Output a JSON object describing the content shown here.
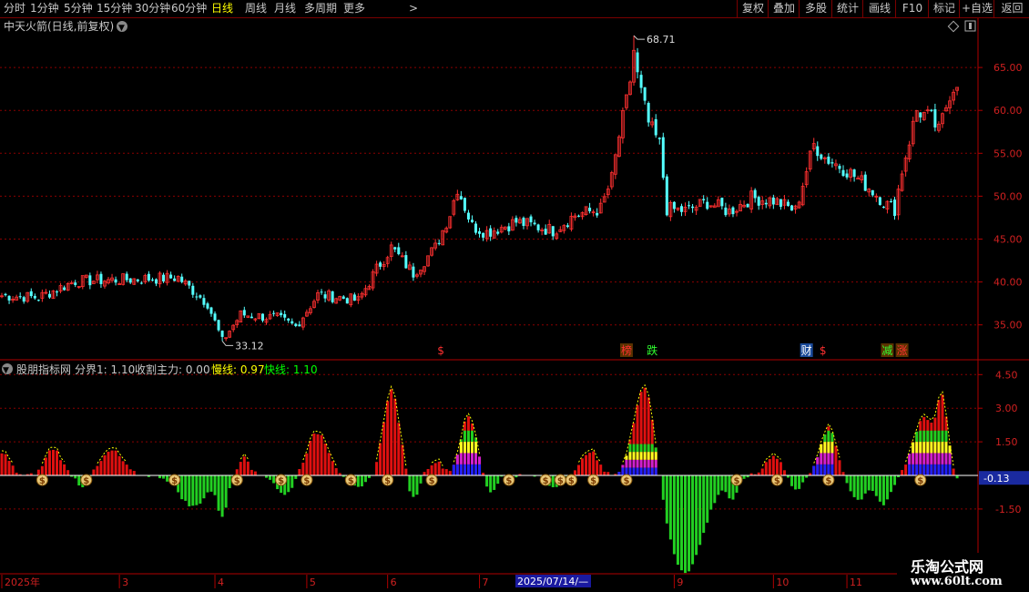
{
  "toolbar": {
    "periods": [
      "分时",
      "1分钟",
      "5分钟",
      "15分钟",
      "30分钟",
      "60分钟",
      "日线",
      "周线",
      "月线",
      "多周期",
      "更多"
    ],
    "active_period": "日线",
    "more_arrow": ">",
    "actions": [
      "复权",
      "叠加",
      "多股",
      "统计",
      "画线",
      "F10",
      "标记",
      "+自选",
      "返回"
    ]
  },
  "colors": {
    "up": "#ff3030",
    "down": "#54ffff",
    "grid": "#8b0000",
    "slow_line": "#ffff00",
    "fast_line": "#00ff00",
    "hist_up": "#e01010",
    "hist_down": "#22d022"
  },
  "main_panel": {
    "title": "中天火箭(日线,前复权)",
    "max_label": "68.71",
    "min_label": "33.12",
    "y_ticks": [
      "65.00",
      "60.00",
      "55.00",
      "50.00",
      "45.00",
      "40.00",
      "35.00"
    ],
    "markers": [
      {
        "text": "$",
        "color": "#ff3030",
        "day": 120
      },
      {
        "text": "榜",
        "color": "#ff3030",
        "bg": "#5a3200",
        "day": 170
      },
      {
        "text": "跌",
        "color": "#30ff30",
        "day": 177
      },
      {
        "text": "财",
        "color": "#ffffff",
        "bg": "#1a4a9a",
        "day": 219
      },
      {
        "text": "$",
        "color": "#ff3030",
        "day": 224
      },
      {
        "text": "减",
        "color": "#30ff30",
        "bg": "#5a3200",
        "day": 241
      },
      {
        "text": "涨",
        "color": "#ff3030",
        "bg": "#5a3200",
        "day": 245
      }
    ]
  },
  "sub_panel": {
    "title": "股朋指标网",
    "labels": [
      {
        "text": "分界1: 1.10",
        "color": "#c8c8c8"
      },
      {
        "text": "收割主力: 0.00",
        "color": "#c8c8c8"
      },
      {
        "text": "慢线: 0.97",
        "color": "#ffff00"
      },
      {
        "text": "快线: 1.10",
        "color": "#00ff00"
      }
    ],
    "y_ticks": [
      "4.50",
      "3.00",
      "1.50",
      "-1.50"
    ],
    "current_value": "-0.13"
  },
  "x_axis": {
    "labels": [
      "2025年",
      "3",
      "4",
      "5",
      "6",
      "7",
      "9",
      "10",
      "11"
    ],
    "highlight": "2025/07/14/—"
  },
  "watermark": {
    "line1": "乐淘公式网",
    "line2": "www.60lt.com"
  },
  "chart_data": {
    "type": "candlestick",
    "key_points": [
      [
        0,
        38.4
      ],
      [
        10,
        38.2
      ],
      [
        20,
        40.1
      ],
      [
        35,
        40.3
      ],
      [
        48,
        40.5
      ],
      [
        56,
        37.5
      ],
      [
        60,
        33.1
      ],
      [
        65,
        36.2
      ],
      [
        75,
        35.8
      ],
      [
        80,
        34.8
      ],
      [
        86,
        38.5
      ],
      [
        92,
        38.2
      ],
      [
        97,
        37.8
      ],
      [
        102,
        41.5
      ],
      [
        106,
        44.0
      ],
      [
        112,
        41.0
      ],
      [
        118,
        44.0
      ],
      [
        122,
        48.0
      ],
      [
        124,
        51.0
      ],
      [
        128,
        46.5
      ],
      [
        132,
        45.8
      ],
      [
        140,
        47.0
      ],
      [
        150,
        46.0
      ],
      [
        156,
        47.8
      ],
      [
        163,
        48.5
      ],
      [
        166,
        52.0
      ],
      [
        168,
        57.0
      ],
      [
        170,
        61.0
      ],
      [
        172,
        66.0
      ],
      [
        174,
        62.0
      ],
      [
        176,
        58.5
      ],
      [
        179,
        56.0
      ],
      [
        181,
        48.5
      ],
      [
        186,
        48.3
      ],
      [
        192,
        49.3
      ],
      [
        198,
        48.2
      ],
      [
        204,
        49.8
      ],
      [
        210,
        49.5
      ],
      [
        216,
        48.3
      ],
      [
        219,
        53.0
      ],
      [
        221,
        56.0
      ],
      [
        224,
        54.5
      ],
      [
        230,
        53.0
      ],
      [
        236,
        51.0
      ],
      [
        241,
        49.0
      ],
      [
        243,
        48.5
      ],
      [
        245,
        53.0
      ],
      [
        247,
        56.5
      ],
      [
        249,
        60.0
      ],
      [
        253,
        59.0
      ],
      [
        255,
        57.5
      ],
      [
        258,
        62.0
      ],
      [
        260,
        63.5
      ]
    ],
    "ylim": [
      31.5,
      71.0
    ],
    "y_ticks": [
      65,
      60,
      55,
      50,
      45,
      40,
      35
    ],
    "indicator": {
      "name": "股朋指标网",
      "ylim": [
        -4.2,
        5.8
      ],
      "y_ticks": [
        4.5,
        3.0,
        1.5,
        -1.5
      ],
      "current": -0.13,
      "bumps": [
        {
          "c": 0,
          "w": 3,
          "a": 1.0
        },
        {
          "c": 14,
          "w": 3,
          "a": 1.2
        },
        {
          "c": 22,
          "w": 2,
          "a": -0.5
        },
        {
          "c": 30,
          "w": 4,
          "a": 1.1
        },
        {
          "c": 52,
          "w": 5,
          "a": -1.4
        },
        {
          "c": 60,
          "w": 2,
          "a": -1.7
        },
        {
          "c": 66,
          "w": 2,
          "a": 0.9
        },
        {
          "c": 77,
          "w": 3,
          "a": -0.9
        },
        {
          "c": 86,
          "w": 4,
          "a": 1.9
        },
        {
          "c": 97,
          "w": 3,
          "a": -0.6
        },
        {
          "c": 106,
          "w": 3,
          "a": 3.8
        },
        {
          "c": 112,
          "w": 2,
          "a": -1.1
        },
        {
          "c": 118,
          "w": 3,
          "a": 0.6
        },
        {
          "c": 127,
          "w": 3,
          "a": 2.6
        },
        {
          "c": 133,
          "w": 2,
          "a": -0.8
        },
        {
          "c": 150,
          "w": 3,
          "a": -0.5
        },
        {
          "c": 160,
          "w": 3,
          "a": 1.1
        },
        {
          "c": 175,
          "w": 4,
          "a": 4.3
        },
        {
          "c": 186,
          "w": 7,
          "a": -4.3
        },
        {
          "c": 199,
          "w": 2,
          "a": -1.0
        },
        {
          "c": 210,
          "w": 3,
          "a": 0.9
        },
        {
          "c": 216,
          "w": 2,
          "a": -0.7
        },
        {
          "c": 225,
          "w": 3,
          "a": 2.1
        },
        {
          "c": 233,
          "w": 3,
          "a": -1.1
        },
        {
          "c": 240,
          "w": 3,
          "a": -1.3
        },
        {
          "c": 251,
          "w": 4,
          "a": 2.6
        },
        {
          "c": 256,
          "w": 2,
          "a": 3.1
        }
      ],
      "stack_regions": [
        [
          123,
          130,
          0.5
        ],
        [
          167,
          179,
          0.35
        ],
        [
          221,
          226,
          0.5
        ],
        [
          247,
          258,
          0.5
        ]
      ],
      "money_icons": [
        11,
        23,
        47,
        64,
        76,
        83,
        95,
        105,
        117,
        138,
        148,
        152,
        155,
        161,
        170,
        200,
        211,
        225,
        250
      ]
    }
  }
}
